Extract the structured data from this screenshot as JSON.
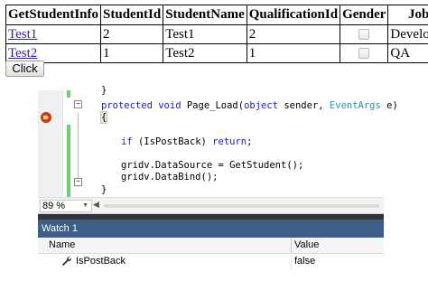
{
  "grid": {
    "headers": [
      "GetStudentInfo",
      "StudentId",
      "StudentName",
      "QualificationId",
      "Gender",
      "Job"
    ],
    "rows": [
      {
        "link": "Test1",
        "id": "2",
        "name": "Test1",
        "qual": "2",
        "job": "Developer"
      },
      {
        "link": "Test2",
        "id": "1",
        "name": "Test2",
        "qual": "1",
        "job": "QA"
      }
    ]
  },
  "button": {
    "label": "Click"
  },
  "editor": {
    "partial": "}",
    "signature": {
      "kw1": "protected",
      "kw2": "void",
      "name": " Page_Load(",
      "kw3": "object",
      "mid": " sender, ",
      "type": "EventArgs",
      "end": " e)"
    },
    "open_brace": "{",
    "if_kw": "if",
    "if_rest": " (IsPostBack) ",
    "return_kw": "return",
    "return_end": ";",
    "line_datasource": "gridv.DataSource = GetStudent();",
    "line_databind": "gridv.DataBind();",
    "close_brace": "}",
    "partial_bottom": "..."
  },
  "status": {
    "zoom": "89 %"
  },
  "watch": {
    "title": "Watch 1",
    "col_name": "Name",
    "col_value": "Value",
    "row": {
      "name": "IsPostBack",
      "value": "false"
    }
  }
}
